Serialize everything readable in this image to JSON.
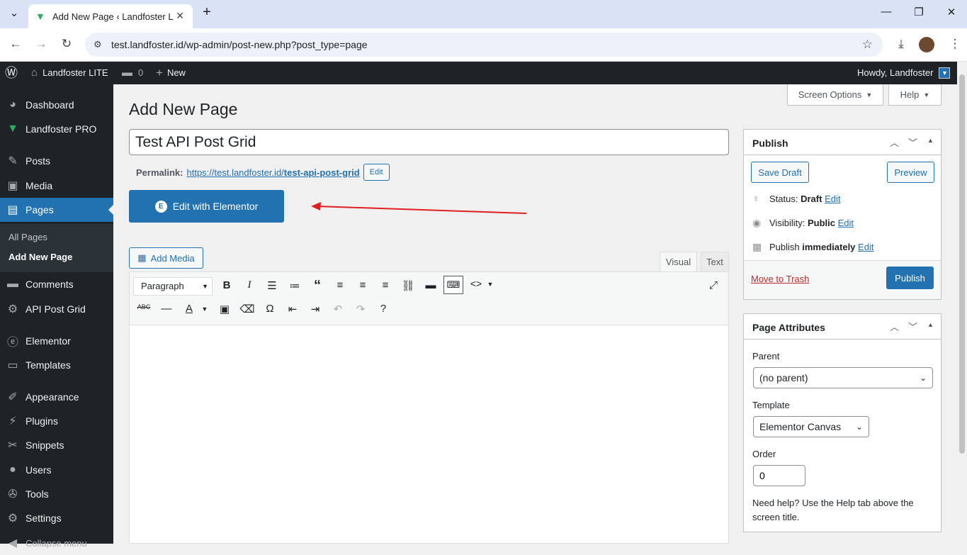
{
  "browser": {
    "tab_title": "Add New Page ‹ Landfoster LITE",
    "url": "test.landfoster.id/wp-admin/post-new.php?post_type=page"
  },
  "adminbar": {
    "site_name": "Landfoster LITE",
    "comments_count": "0",
    "new_label": "New",
    "howdy": "Howdy, Landfoster"
  },
  "sidebar": {
    "items": [
      {
        "label": "Dashboard",
        "icon": "dashboard-icon"
      },
      {
        "label": "Landfoster PRO",
        "icon": "landfoster-icon"
      },
      {
        "label": "Posts",
        "icon": "pin-icon"
      },
      {
        "label": "Media",
        "icon": "media-icon"
      },
      {
        "label": "Pages",
        "icon": "pages-icon"
      },
      {
        "label": "Comments",
        "icon": "comment-icon"
      },
      {
        "label": "API Post Grid",
        "icon": "gear-icon"
      },
      {
        "label": "Elementor",
        "icon": "elementor-icon"
      },
      {
        "label": "Templates",
        "icon": "folder-icon"
      },
      {
        "label": "Appearance",
        "icon": "brush-icon"
      },
      {
        "label": "Plugins",
        "icon": "plugin-icon"
      },
      {
        "label": "Snippets",
        "icon": "scissors-icon"
      },
      {
        "label": "Users",
        "icon": "user-icon"
      },
      {
        "label": "Tools",
        "icon": "wrench-icon"
      },
      {
        "label": "Settings",
        "icon": "settings-icon"
      },
      {
        "label": "Collapse menu",
        "icon": "collapse-icon"
      }
    ],
    "submenu": [
      "All Pages",
      "Add New Page"
    ]
  },
  "screen_options": "Screen Options",
  "help": "Help",
  "page_title": "Add New Page",
  "post_title_value": "Test API Post Grid",
  "permalink": {
    "label": "Permalink:",
    "url_base": "https://test.landfoster.id/",
    "slug": "test-api-post-grid",
    "edit": "Edit"
  },
  "elementor_button": "Edit with Elementor",
  "add_media": "Add Media",
  "editor_tabs": {
    "visual": "Visual",
    "text": "Text"
  },
  "format_select": "Paragraph",
  "publish_box": {
    "title": "Publish",
    "save_draft": "Save Draft",
    "preview": "Preview",
    "status_label": "Status:",
    "status_value": "Draft",
    "visibility_label": "Visibility:",
    "visibility_value": "Public",
    "publish_label": "Publish",
    "publish_value": "immediately",
    "edit": "Edit",
    "trash": "Move to Trash",
    "publish_button": "Publish"
  },
  "page_attributes": {
    "title": "Page Attributes",
    "parent_label": "Parent",
    "parent_value": "(no parent)",
    "template_label": "Template",
    "template_value": "Elementor Canvas",
    "order_label": "Order",
    "order_value": "0",
    "help_text": "Need help? Use the Help tab above the screen title."
  },
  "colors": {
    "wp_blue": "#2271b1",
    "admin_dark": "#1d2327",
    "annotation_red": "#e02020"
  }
}
